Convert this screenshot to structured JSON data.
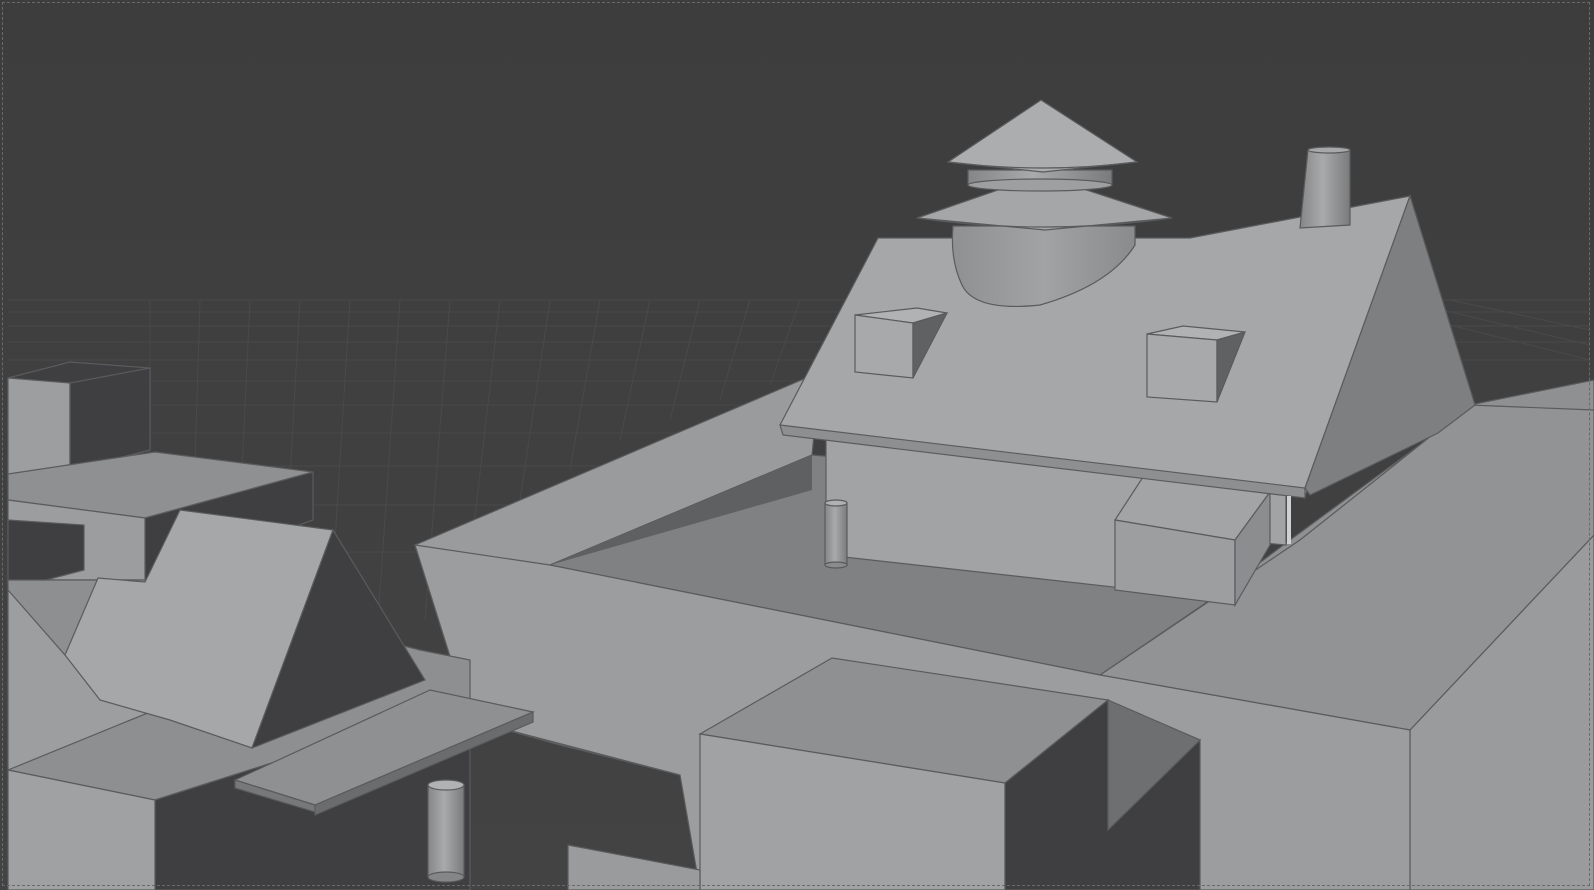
{
  "viewport": {
    "type": "3d-viewport",
    "shading": "solid",
    "grid": true,
    "colors": {
      "background": "#3d3d3d",
      "grid_line": "#4a4a4a",
      "surface_light": "#a6a7a8",
      "surface_mid": "#8e8f90",
      "surface_dark": "#3f3e40",
      "outline": "#555658"
    }
  }
}
